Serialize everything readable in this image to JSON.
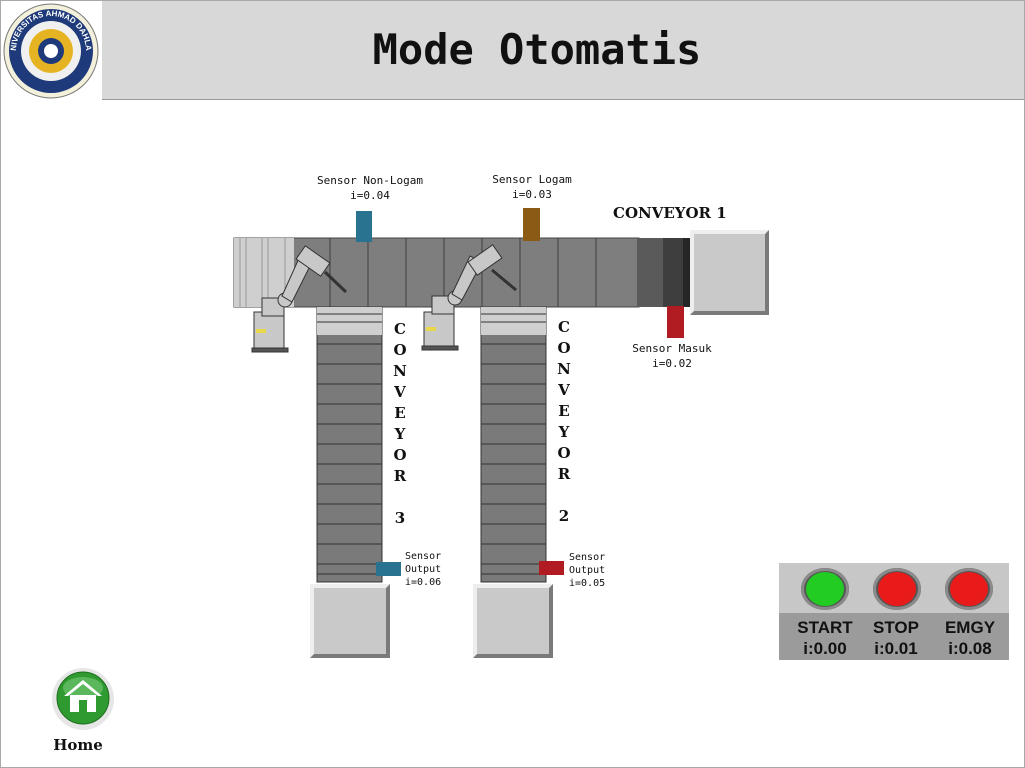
{
  "window": {
    "title": "Mode Otomatis"
  },
  "logo": {
    "text": "UNIVERSITAS AHMAD DAHLAN"
  },
  "conveyors": {
    "c1": "CONVEYOR 1",
    "c3_letters": [
      "C",
      "O",
      "N",
      "V",
      "E",
      "Y",
      "O",
      "R",
      "",
      "3"
    ],
    "c2_letters": [
      "C",
      "O",
      "N",
      "V",
      "E",
      "Y",
      "O",
      "R",
      "",
      "2"
    ]
  },
  "sensors": {
    "non_logam": {
      "name": "Sensor Non-Logam",
      "addr": "i=0.04",
      "color": "#2a7390"
    },
    "logam": {
      "name": "Sensor Logam",
      "addr": "i=0.03",
      "color": "#8b5a14"
    },
    "masuk": {
      "name": "Sensor Masuk",
      "addr": "i=0.02",
      "color": "#b01c22"
    },
    "output3": {
      "line1": "Sensor",
      "line2": "Output",
      "addr": "i=0.06",
      "color": "#2a7390"
    },
    "output2": {
      "line1": "Sensor",
      "line2": "Output",
      "addr": "i=0.05",
      "color": "#b01c22"
    }
  },
  "controls": {
    "start": {
      "label": "START",
      "addr": "i:0.00",
      "color": "#22cc22"
    },
    "stop": {
      "label": "STOP",
      "addr": "i:0.01",
      "color": "#e81a1a"
    },
    "emgy": {
      "label": "EMGY",
      "addr": "i:0.08",
      "color": "#e81a1a"
    }
  },
  "nav": {
    "home_label": "Home"
  }
}
